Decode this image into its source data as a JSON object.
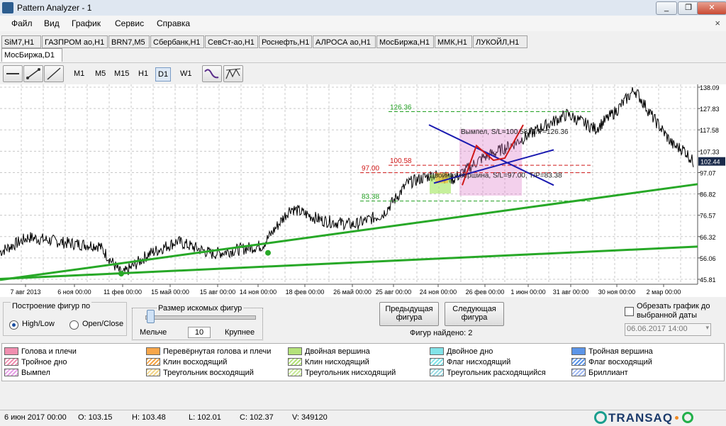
{
  "window": {
    "title": "Pattern Analyzer - 1",
    "min": "_",
    "restore": "❐",
    "close": "✕"
  },
  "menu": {
    "items": [
      "Файл",
      "Вид",
      "График",
      "Сервис",
      "Справка"
    ],
    "close": "×"
  },
  "tabs": [
    "SiM7,H1",
    "ГАЗПРОМ ао,H1",
    "BRN7,M5",
    "Сбербанк,H1",
    "СевСт-ао,H1",
    "Роснефть,H1",
    "АЛРОСА ао,H1",
    "МосБиржа,H1",
    "ММК,H1",
    "ЛУКОЙЛ,H1",
    "МосБиржа,D1"
  ],
  "timeframes": [
    "M1",
    "M5",
    "M15",
    "H1",
    "D1",
    "W1"
  ],
  "active_timeframe": "D1",
  "chart": {
    "y_ticks": [
      "138.09",
      "127.83",
      "117.58",
      "107.33",
      "97.07",
      "86.82",
      "76.57",
      "66.32",
      "56.06",
      "45.81"
    ],
    "x_ticks": [
      "7 авг 2013",
      "6 ноя 00:00",
      "11 фев 00:00",
      "15 май 00:00",
      "15 авг 00:00",
      "14 ноя 00:00",
      "18 фев 00:00",
      "26 май 00:00",
      "25 авг 00:00",
      "24 ноя 00:00",
      "26 фев 00:00",
      "1 июн 00:00",
      "31 авг 00:00",
      "30 ноя 00:00",
      "2 мар 00:00"
    ],
    "current_price": "102.44",
    "levels": {
      "tp_pennant": "126.36",
      "entry_pennant": "100.58",
      "sl_top": "97.00",
      "tp_top": "83.38"
    },
    "annotations": {
      "pennant": "Вымпел, S/L=100.58, T/P=126.36",
      "double_top": "Двойная вершина, S/L=97.00, T/P=83.38"
    }
  },
  "controls": {
    "build_group_title": "Построение фигур по",
    "radio_highlow": "High/Low",
    "radio_openclose": "Open/Close",
    "size_title": "Размер искомых фигур",
    "smaller": "Мельче",
    "size_value": "10",
    "larger": "Крупнее",
    "prev_button": "Предыдущая фигура",
    "next_button": "Следующая фигура",
    "found": "Фигур найдено: 2",
    "crop_label": "Обрезать график до выбранной даты",
    "crop_date": "06.06.2017 14:00"
  },
  "legend": [
    {
      "label": "Голова и плечи",
      "color": "#f08fb0",
      "hatch": false
    },
    {
      "label": "Перевёрнутая голова и плечи",
      "color": "#f7a64a",
      "hatch": false
    },
    {
      "label": "Двойная вершина",
      "color": "#b4e27a",
      "hatch": false
    },
    {
      "label": "Двойное дно",
      "color": "#82e3e8",
      "hatch": false
    },
    {
      "label": "Тройная вершина",
      "color": "#5c95e8",
      "hatch": false
    },
    {
      "label": "Тройное дно",
      "color": "#f08fb0",
      "hatch": true
    },
    {
      "label": "Клин восходящий",
      "color": "#f7a64a",
      "hatch": true
    },
    {
      "label": "Клин нисходящий",
      "color": "#b4e27a",
      "hatch": true
    },
    {
      "label": "Флаг нисходящий",
      "color": "#82e3e8",
      "hatch": true
    },
    {
      "label": "Флаг восходящий",
      "color": "#5c95e8",
      "hatch": true
    },
    {
      "label": "Вымпел",
      "color": "#e6a0e6",
      "hatch": true
    },
    {
      "label": "Треугольник восходящий",
      "color": "#f2d48a",
      "hatch": true
    },
    {
      "label": "Треугольник нисходящий",
      "color": "#c8e89a",
      "hatch": true
    },
    {
      "label": "Треугольник расходящийся",
      "color": "#9ad8e0",
      "hatch": true
    },
    {
      "label": "Бриллиант",
      "color": "#a0b8f0",
      "hatch": true
    }
  ],
  "status": {
    "date": "6 июн 2017 00:00",
    "open": "O: 103.15",
    "high": "H: 103.48",
    "low": "L: 102.01",
    "close": "C: 102.37",
    "volume": "V: 349120",
    "brand": "TRANSAQ"
  }
}
